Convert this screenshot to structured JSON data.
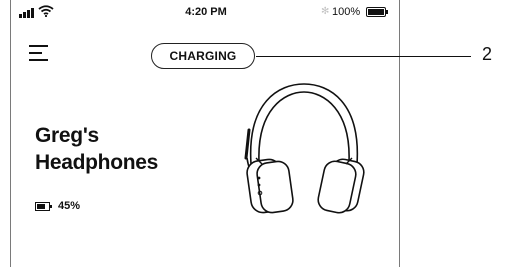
{
  "status_bar": {
    "time": "4:20 PM",
    "battery_percent": "100%",
    "bluetooth_symbol": "✻",
    "icons": [
      "signal-icon",
      "wifi-icon",
      "bluetooth-icon",
      "battery-icon"
    ]
  },
  "header": {
    "menu_icon": "hamburger-menu-icon",
    "status_label": "CHARGING"
  },
  "device": {
    "name_line1": "Greg's",
    "name_line2": "Headphones",
    "battery_percent": "45%",
    "battery_level": 0.45,
    "image_icon": "headphones-icon"
  },
  "annotation": {
    "callout_number": "2"
  }
}
